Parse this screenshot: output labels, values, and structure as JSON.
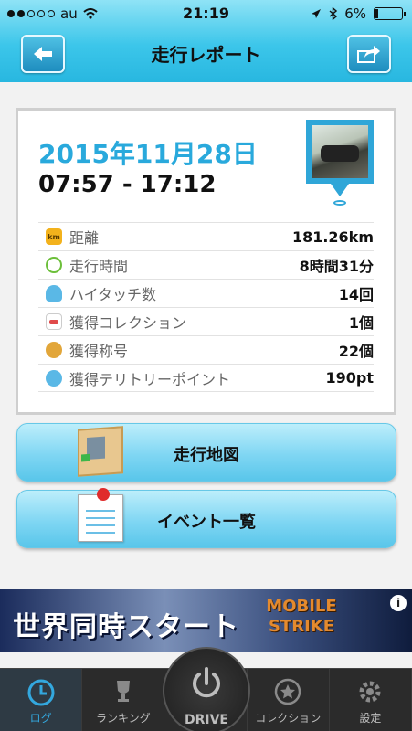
{
  "status_bar": {
    "carrier": "au",
    "time": "21:19",
    "battery": "6%"
  },
  "header": {
    "title": "走行レポート",
    "back_icon": "left-arrow-icon",
    "share_icon": "share-arrow-icon"
  },
  "report": {
    "date": "2015年11月28日",
    "time_range": "07:57 - 17:12",
    "stats": [
      {
        "label": "距離",
        "value": "181.26km",
        "icon": "km-icon"
      },
      {
        "label": "走行時間",
        "value": "8時間31分",
        "icon": "clock-icon"
      },
      {
        "label": "ハイタッチ数",
        "value": "14回",
        "icon": "hand-icon"
      },
      {
        "label": "獲得コレクション",
        "value": "1個",
        "icon": "collection-icon"
      },
      {
        "label": "獲得称号",
        "value": "22個",
        "icon": "medal-icon"
      },
      {
        "label": "獲得テリトリーポイント",
        "value": "190pt",
        "icon": "territory-icon"
      }
    ]
  },
  "actions": {
    "map_label": "走行地図",
    "event_label": "イベント一覧"
  },
  "ad": {
    "text": "世界同時スタート",
    "brand": "MOBILE STRIKE",
    "info": "i"
  },
  "tabs": [
    {
      "label": "ログ",
      "icon": "log-clock-icon"
    },
    {
      "label": "ランキング",
      "icon": "trophy-icon"
    },
    {
      "label": "DRIVE",
      "icon": "power-icon"
    },
    {
      "label": "コレクション",
      "icon": "star-icon"
    },
    {
      "label": "設定",
      "icon": "gear-icon"
    }
  ]
}
